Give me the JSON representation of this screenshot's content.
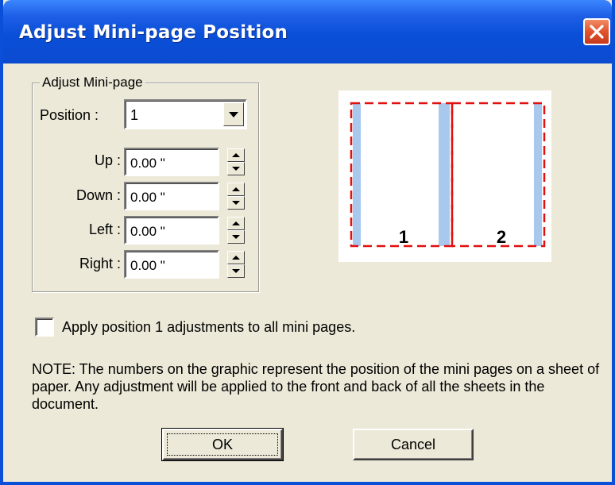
{
  "window": {
    "title": "Adjust Mini-page Position",
    "close_icon": "close-icon"
  },
  "group": {
    "title": "Adjust Mini-page",
    "position_label": "Position :",
    "position_value": "1",
    "fields": [
      {
        "label": "Up :",
        "value": "0.00 \""
      },
      {
        "label": "Down :",
        "value": "0.00 \""
      },
      {
        "label": "Left :",
        "value": "0.00 \""
      },
      {
        "label": "Right :",
        "value": "0.00 \""
      }
    ]
  },
  "preview": {
    "page_numbers": [
      "1",
      "2"
    ],
    "colors": {
      "dash": "#e01010",
      "margin": "#a8c8ee",
      "background": "#ffffff"
    }
  },
  "checkbox": {
    "label": "Apply position 1 adjustments to all mini pages.",
    "checked": false
  },
  "note": "NOTE: The numbers on the graphic represent the position of the mini pages on a sheet of paper.  Any adjustment will be applied to the front and back of all the sheets in the document.",
  "buttons": {
    "ok": "OK",
    "cancel": "Cancel"
  }
}
